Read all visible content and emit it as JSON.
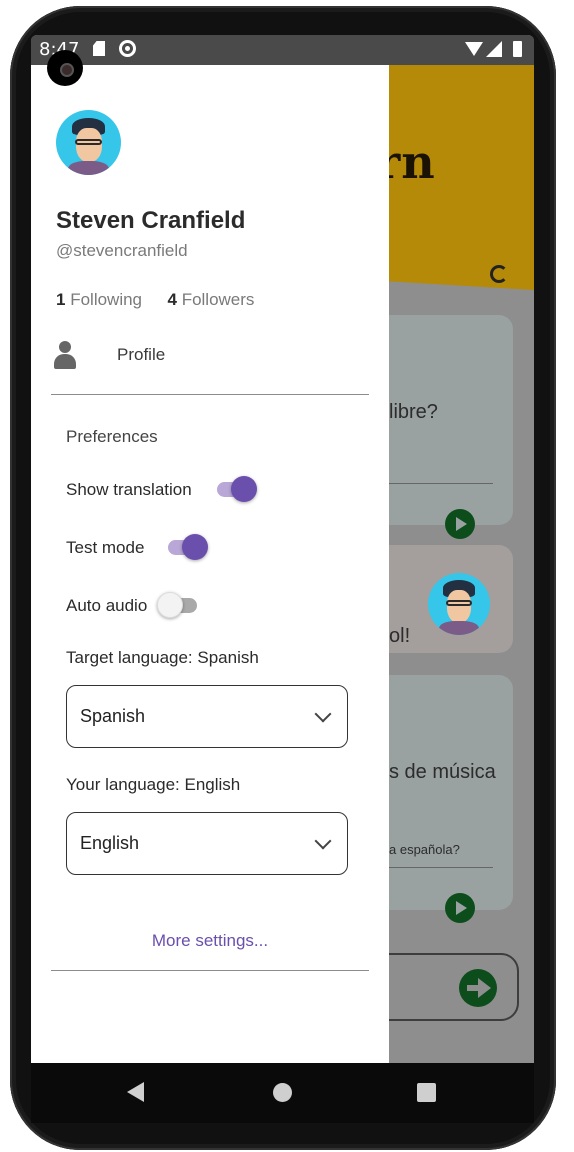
{
  "status_bar": {
    "time": "8:47",
    "icons": [
      "sd-card-icon",
      "sync-icon",
      "wifi-icon",
      "signal-icon",
      "battery-icon"
    ]
  },
  "background_app": {
    "title_fragment": "rn",
    "card1_text": "libre?",
    "card2_text": "ol!",
    "card3_text": "s de música",
    "card3_sub": "a española?"
  },
  "drawer": {
    "user": {
      "name": "Steven Cranfield",
      "handle": "@stevencranfield"
    },
    "following_count": "1",
    "following_label": "Following",
    "followers_count": "4",
    "followers_label": "Followers",
    "profile_label": "Profile",
    "preferences_title": "Preferences",
    "settings": {
      "show_translation": {
        "label": "Show translation",
        "on": true
      },
      "test_mode": {
        "label": "Test mode",
        "on": true
      },
      "auto_audio": {
        "label": "Auto audio",
        "on": false
      }
    },
    "target_language_label": "Target language: Spanish",
    "target_language_value": "Spanish",
    "your_language_label": "Your language: English",
    "your_language_value": "English",
    "more_settings": "More settings..."
  },
  "colors": {
    "accent": "#6a4fad",
    "header": "#b58a08",
    "play": "#0d4d1c"
  }
}
